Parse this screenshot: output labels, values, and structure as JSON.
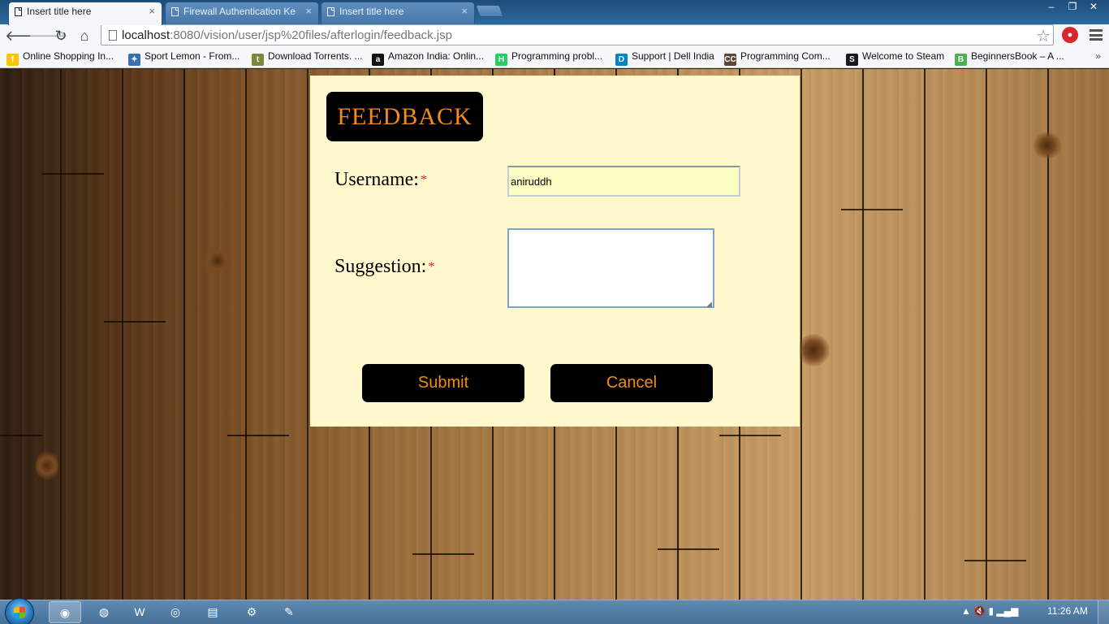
{
  "browser": {
    "tabs": [
      {
        "title": "Insert title here",
        "active": true
      },
      {
        "title": "Firewall Authentication Ke",
        "active": false
      },
      {
        "title": "Insert title here",
        "active": false
      }
    ],
    "close_glyph": "×",
    "window_controls": {
      "minimize": "–",
      "restore": "❐",
      "close": "✕"
    },
    "url_host": "localhost",
    "url_rest": ":8080/vision/user/jsp%20files/afterlogin/feedback.jsp",
    "star": "☆",
    "bookmarks": [
      {
        "label": "Online Shopping In...",
        "icon": "flipkart-icon",
        "glyph": "f",
        "color": "#f7c600"
      },
      {
        "label": "Sport Lemon - From...",
        "icon": "runner-icon",
        "glyph": "✦",
        "color": "#3b6fb3"
      },
      {
        "label": "Download Torrents. ...",
        "icon": "shield-icon",
        "glyph": "t",
        "color": "#7a8a3a"
      },
      {
        "label": "Amazon India: Onlin...",
        "icon": "amazon-icon",
        "glyph": "a",
        "color": "#111111"
      },
      {
        "label": "Programming probl...",
        "icon": "hackerrank-icon",
        "glyph": "H",
        "color": "#2ec866"
      },
      {
        "label": "Support | Dell India",
        "icon": "dell-icon",
        "glyph": "D",
        "color": "#0085c3"
      },
      {
        "label": "Programming Com...",
        "icon": "codechef-icon",
        "glyph": "CC",
        "color": "#5b4638"
      },
      {
        "label": "Welcome to Steam",
        "icon": "steam-icon",
        "glyph": "S",
        "color": "#171a21"
      },
      {
        "label": "BeginnersBook – A ...",
        "icon": "beginnersbook-icon",
        "glyph": "B",
        "color": "#4caf50"
      }
    ],
    "bookmarks_overflow": "»"
  },
  "form": {
    "heading": "FEEDBACK",
    "username_label": "Username:",
    "suggestion_label": "Suggestion:",
    "required_mark": "*",
    "username_value": "aniruddh",
    "suggestion_value": "",
    "submit_label": "Submit",
    "cancel_label": "Cancel",
    "colors": {
      "card": "#fff8cd",
      "accent": "#f28c18",
      "required": "#e0221c"
    }
  },
  "taskbar": {
    "apps": [
      {
        "name": "chrome",
        "glyph": "◉",
        "active": true
      },
      {
        "name": "firefox",
        "glyph": "◍",
        "active": false
      },
      {
        "name": "word",
        "glyph": "W",
        "active": false
      },
      {
        "name": "app",
        "glyph": "◎",
        "active": false
      },
      {
        "name": "explorer",
        "glyph": "▤",
        "active": false
      },
      {
        "name": "settings",
        "glyph": "⚙",
        "active": false
      },
      {
        "name": "paint",
        "glyph": "✎",
        "active": false
      }
    ],
    "tray_icons": "▲  🔇  ▮  ▂▄▆",
    "clock": "11:26 AM"
  }
}
